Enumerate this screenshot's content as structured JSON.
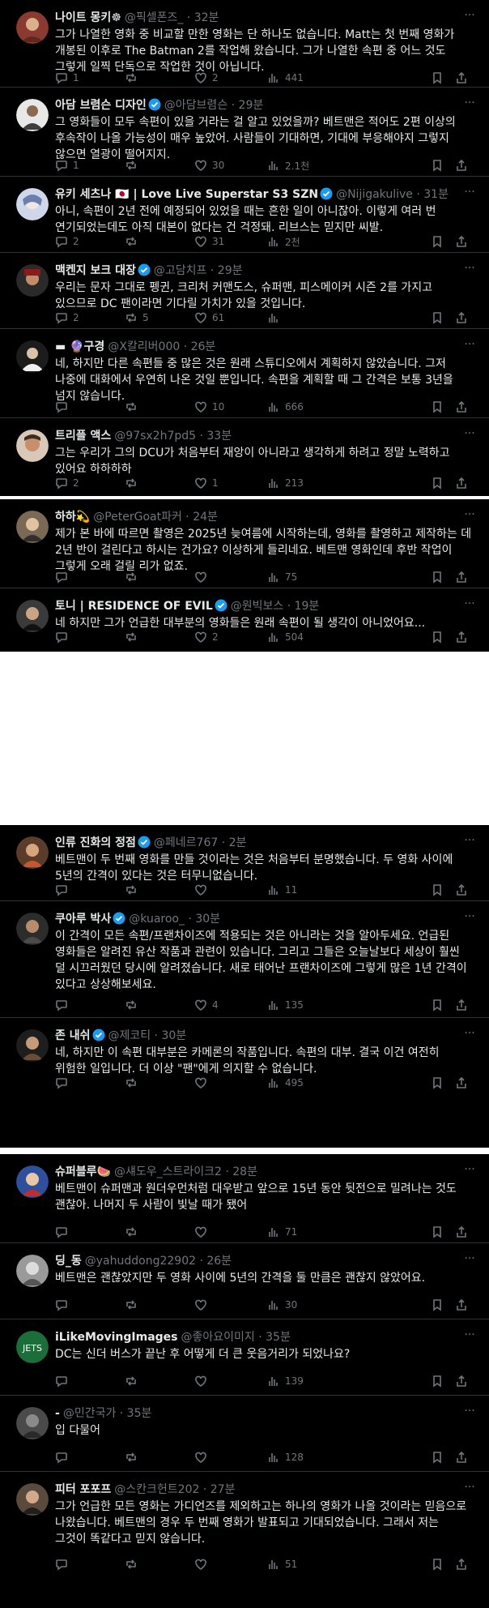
{
  "colors": {
    "background": "#000000",
    "text": "#e7e9ea",
    "muted": "#71767b",
    "divider": "#2f3336",
    "verified": "#1d9bf0"
  },
  "panels": [
    {
      "tweets": [
        {
          "name": "나이트 몽키",
          "name_suffix": "☸",
          "handle": "@픽셀폰즈_ · 32분",
          "verified": false,
          "text": "그가 나열한 영화 중 비교할 만한 영화는 단 하나도 없습니다. Matt는 첫 번째 영화가 개봉된 이후로 The Batman 2를 작업해 왔습니다. 그가 나열한 속편 중 어느 것도 그렇게 일찍 단독으로 작업한 것이 아닙니다.",
          "reply": "1",
          "repost": "",
          "like": "2",
          "views": "441"
        },
        {
          "name": "아담 브렴슨 디자인",
          "name_suffix": "",
          "handle": "@아담브렴슨 · 29분",
          "verified": true,
          "text": "그 영화들이 모두 속편이 있을 거라는 걸 알고 있었을까? 베트맨은 적어도 2편 이상의 후속작이 나올 가능성이 매우 높았어. 사람들이 기대하면, 기대에 부응해야지 그렇지 않으면 열광이 떨어지지.",
          "reply": "1",
          "repost": "",
          "like": "30",
          "views": "2.1천"
        },
        {
          "name": "유키 세츠나",
          "name_suffix": " 🇯🇵 | Love Live Superstar S3 SZN",
          "handle": "@Nijigakulive · 31분",
          "verified": true,
          "text": "아니, 속편이 2년 전에 예정되어 있었을 때는 흔한 일이 아니잖아. 이렇게 여러 번 연기되었는데도 아직 대본이 없다는 건 걱정돼. 리브스는 믿지만 씨발.",
          "reply": "2",
          "repost": "",
          "like": "31",
          "views": "2천"
        },
        {
          "name": "맥켄지 보크 대장",
          "name_suffix": "",
          "handle": "@고담치프 · 29분",
          "verified": true,
          "text": "우리는 문자 그대로 펭귄, 크리처 커맨도스, 슈퍼맨, 피스메이커 시즌 2를 가지고 있으므로 DC 팬이라면 기다릴 가치가 있을 것입니다.",
          "reply": "2",
          "repost": "5",
          "like": "61",
          "views": ""
        },
        {
          "name": "구경",
          "name_suffix": "",
          "name_prefix": "▬ 🔮",
          "handle": "@X칼리버000 · 26분",
          "verified": false,
          "text": "네, 하지만 다른 속편들 중 많은 것은 원래 스튜디오에서 계획하지 않았습니다. 그저 나중에 대화에서 우연히 나온 것일 뿐입니다. 속편을 계획할 때 그 간격은 보통 3년을 넘지 않습니다.",
          "reply": "",
          "repost": "",
          "like": "10",
          "views": "666"
        },
        {
          "name": "트리플 액스",
          "name_suffix": "",
          "handle": "@97sx2h7pd5 · 33분",
          "verified": false,
          "text": "그는 우리가 그의 DCU가 처음부터 재앙이 아니라고 생각하게 하려고 정말 노력하고 있어요 하하하하",
          "reply": "2",
          "repost": "",
          "like": "1",
          "views": "213"
        }
      ]
    },
    {
      "tweets": [
        {
          "name": "하하",
          "name_suffix": "💫",
          "handle": "@PeterGoat파커 · 24분",
          "verified": false,
          "text": "제가 본 바에 따르면 촬영은 2025년 늦여름에 시작하는데, 영화를 촬영하고 제작하는 데 2년 반이 걸린다고 하시는 건가요? 이상하게 들리네요. 베트맨 영화인데 후반 작업이 그렇게 오래 걸릴 리가 없죠.",
          "reply": "",
          "repost": "",
          "like": "",
          "views": "75"
        },
        {
          "name": "토니 | RESIDENCE OF EVIL",
          "name_suffix": "",
          "handle": "@원빅보스 · 19분",
          "verified": true,
          "text": "네 하지만 그가 언급한 대부분의 영화들은 원래 속편이 될 생각이 아니었어요...",
          "reply": "",
          "repost": "",
          "like": "2",
          "views": "504"
        }
      ]
    },
    {
      "tweets": [
        {
          "name": "인류 진화의 정점",
          "name_suffix": "",
          "handle": "@페네르767 · 2분",
          "verified": true,
          "text": "베트맨이 두 번째 영화를 만들 것이라는 것은 처음부터 분명했습니다. 두 영화 사이에 5년의 간격이 있다는 것은 터무니없습니다.",
          "reply": "",
          "repost": "",
          "like": "",
          "views": "11"
        },
        {
          "name": "쿠아루 박사",
          "name_suffix": "",
          "handle": "@kuaroo_ · 30분",
          "verified": true,
          "text": "이 간격이 모든 속편/프랜차이즈에 적용되는 것은 아니라는 것을 알아두세요. 언급된 영화들은 알려진 유산 작품과 관련이 있습니다. 그리고 그들은 오늘날보다 세상이 훨씬 덜 시끄러웠던 당시에 알려졌습니다. 새로 태어난 프랜차이즈에 그렇게 많은 1년 간격이 있다고 상상해보세요.",
          "reply": "",
          "repost": "",
          "like": "4",
          "views": "135"
        },
        {
          "name": "존 내쉬",
          "name_suffix": "",
          "handle": "@제코티 · 30분",
          "verified": true,
          "text": "네, 하지만 이 속편 대부분은 카메론의 작품입니다. 속편의 대부. 결국 이건 여전히 위험한 일입니다. 더 이상 \"팬\"에게 의지할 수 없습니다.",
          "reply": "",
          "repost": "",
          "like": "",
          "views": "495"
        }
      ]
    },
    {
      "tweets": [
        {
          "name": "슈퍼블루",
          "name_suffix": "🍉",
          "handle": "@섀도우_스트라이크2 · 28분",
          "verified": false,
          "text": "베트맨이 슈퍼맨과 원더우먼처럼 대우받고 앞으로 15년 동안 뒷전으로 밀려나는 것도 괜찮아. 나머지 두 사람이 빛날 때가 됐어",
          "reply": "",
          "repost": "",
          "like": "",
          "views": "71"
        },
        {
          "name": "딩_동",
          "name_suffix": "",
          "handle": "@yahuddong22902 · 26분",
          "verified": false,
          "text": "베트맨은 괜찮았지만 두 영화 사이에 5년의 간격을 둘 만큼은 괜찮지 않았어요.",
          "reply": "",
          "repost": "",
          "like": "",
          "views": "30"
        },
        {
          "name": "iLikeMovingImages",
          "name_suffix": "",
          "handle": "@좋아요이미지 · 35분",
          "verified": false,
          "text": "DC는 신더 버스가 끝난 후 어떻게 더 큰 웃음거리가 되었나요?",
          "reply": "",
          "repost": "",
          "like": "",
          "views": "139"
        },
        {
          "name": "-",
          "name_suffix": "",
          "handle": "@민간국가 · 35분",
          "verified": false,
          "text": "입 다물어",
          "reply": "",
          "repost": "",
          "like": "",
          "views": "128"
        },
        {
          "name": "피터 포포프",
          "name_suffix": "",
          "handle": "@스칸크헌트202 · 27분",
          "verified": false,
          "text": "그가 언급한 모든 영화는 가디언즈를 제외하고는 하나의 영화가 나올 것이라는 믿음으로 나왔습니다. 베트맨의 경우 두 번째 영화가 발표되고 기대되었습니다. 그래서 저는 그것이 똑같다고 믿지 않습니다.",
          "reply": "",
          "repost": "",
          "like": "",
          "views": "51"
        }
      ]
    }
  ]
}
